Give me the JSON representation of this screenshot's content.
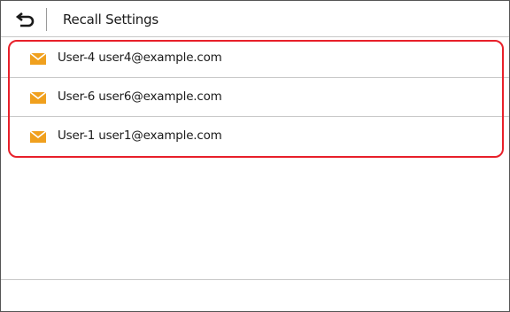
{
  "header": {
    "title": "Recall Settings",
    "back_icon": "back-arrow-icon"
  },
  "recall_list": {
    "items": [
      {
        "label": "User-4 user4@example.com",
        "icon": "envelope-icon"
      },
      {
        "label": "User-6 user6@example.com",
        "icon": "envelope-icon"
      },
      {
        "label": "User-1 user1@example.com",
        "icon": "envelope-icon"
      }
    ]
  },
  "colors": {
    "highlight": "#e8202a",
    "envelope": "#f0a01e"
  }
}
